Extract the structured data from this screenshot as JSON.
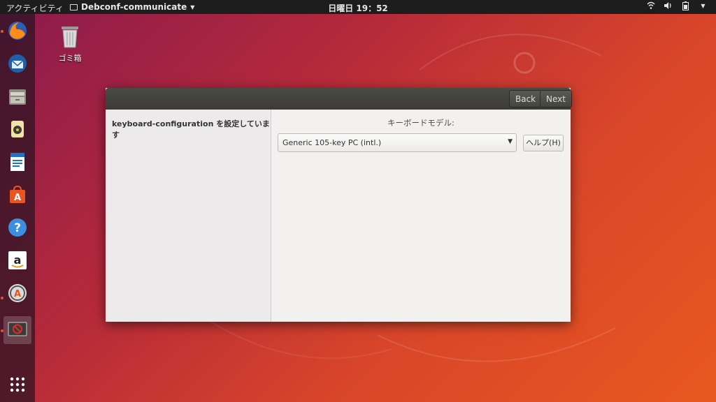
{
  "topbar": {
    "activities": "アクティビティ",
    "app_menu": "Debconf-communicate",
    "clock": "日曜日 19：52",
    "tray_icons": [
      "wifi-icon",
      "volume-icon",
      "battery-icon",
      "system-menu-icon"
    ]
  },
  "dock": {
    "items": [
      {
        "name": "firefox",
        "running": true
      },
      {
        "name": "thunderbird",
        "running": false
      },
      {
        "name": "files",
        "running": false
      },
      {
        "name": "rhythmbox",
        "running": false
      },
      {
        "name": "libreoffice-writer",
        "running": false
      },
      {
        "name": "ubuntu-software",
        "running": false
      },
      {
        "name": "help",
        "running": false
      },
      {
        "name": "amazon",
        "running": false
      },
      {
        "name": "software-updater",
        "running": true
      },
      {
        "name": "debconf-communicate",
        "running": true,
        "active": true
      }
    ],
    "show_apps": "show-applications-icon"
  },
  "desktop": {
    "trash_label": "ゴミ箱"
  },
  "dialog": {
    "back_label": "Back",
    "next_label": "Next",
    "sidebar_title": "keyboard-configuration を設定しています",
    "model_label": "キーボードモデル:",
    "model_value": "Generic 105-key PC (intl.)",
    "help_label": "ヘルプ(H)"
  },
  "colors": {
    "accent": "#e95420",
    "topbar": "#1d1d1d",
    "titlebar": "#3c3b37"
  }
}
